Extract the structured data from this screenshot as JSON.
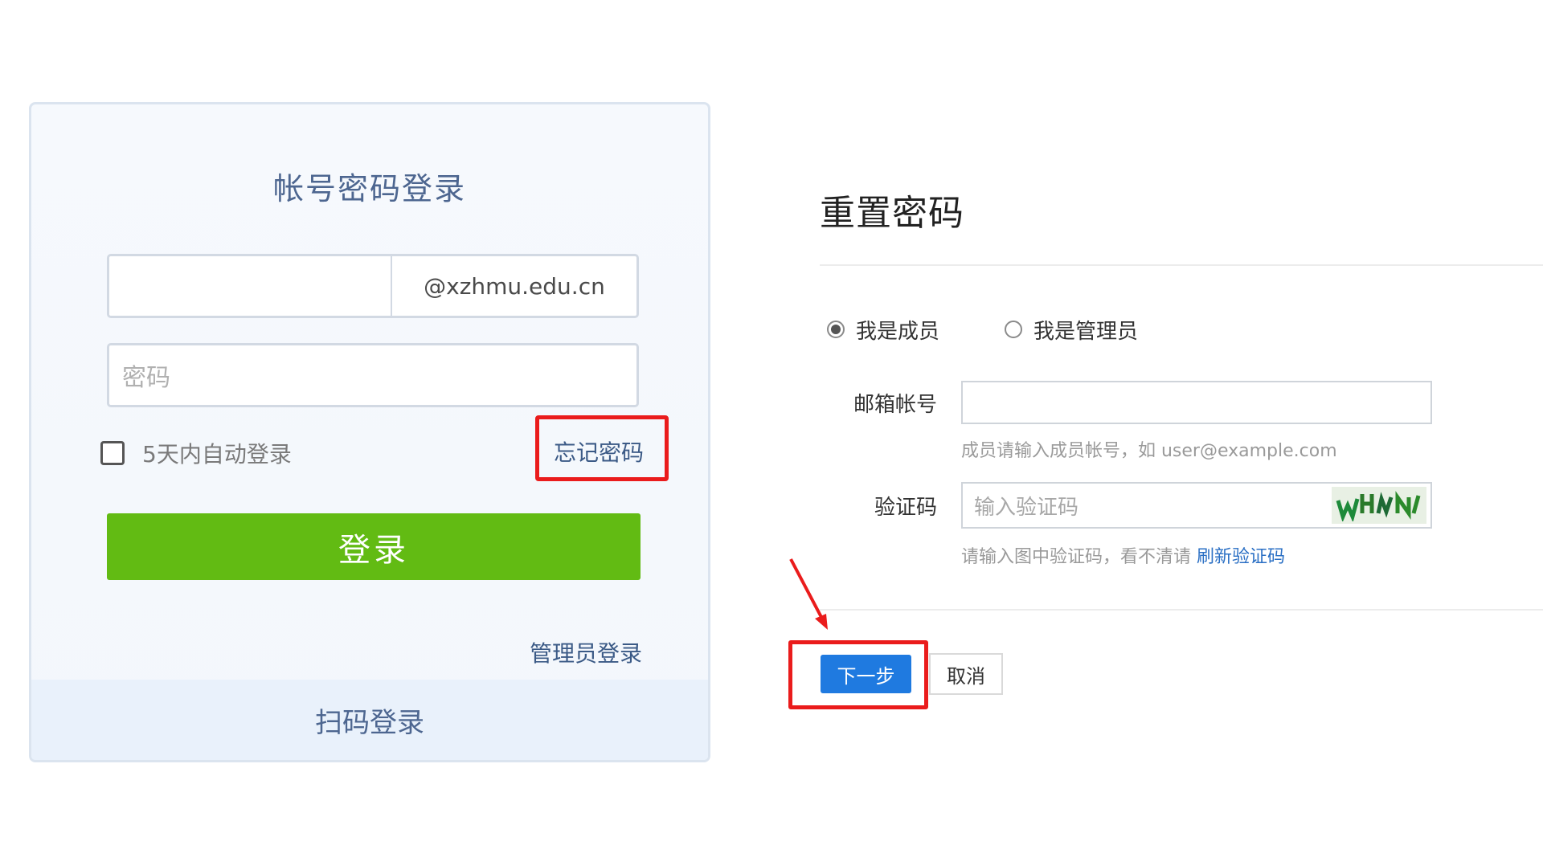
{
  "login": {
    "title": "帐号密码登录",
    "domain_suffix": "@xzhmu.edu.cn",
    "password_placeholder": "密码",
    "auto_login": "5天内自动登录",
    "forgot_password": "忘记密码",
    "login_button": "登录",
    "admin_login": "管理员登录",
    "qr_login": "扫码登录"
  },
  "reset": {
    "title": "重置密码",
    "role_member": "我是成员",
    "role_admin": "我是管理员",
    "selected_role": "我是成员",
    "email_label": "邮箱帐号",
    "email_hint": "成员请输入成员帐号，如 user@example.com",
    "captcha_label": "验证码",
    "captcha_placeholder": "输入验证码",
    "captcha_hint": "请输入图中验证码，看不清请",
    "refresh_captcha": "刷新验证码",
    "next_button": "下一步",
    "cancel_button": "取消"
  },
  "colors": {
    "login_green": "#62bb13",
    "primary_blue": "#1f7ae0",
    "highlight_red": "#ea1c1c",
    "link_blue": "#2a6fc4"
  }
}
